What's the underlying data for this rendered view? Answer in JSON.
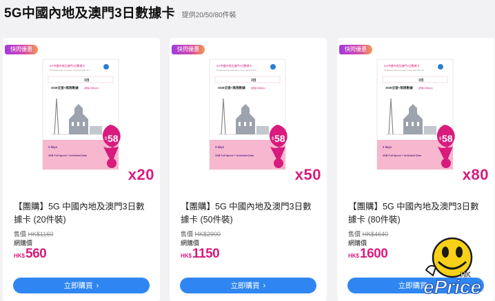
{
  "header": {
    "title": "5G中國內地及澳門3日數據卡",
    "subtitle": "提供20/50/80件裝"
  },
  "card_art": {
    "head": "5G中國內地及澳門3日數據卡",
    "head_en": "5G Mainland China and Macao 3 Days Data SIM Card",
    "days_badge": "3日",
    "mid": "3GB全速+無限數據",
    "mid_note": "(其後128kbps)",
    "days_en": "3 days",
    "data_en": "3GB Full Speed + Unlimited Data",
    "price_tag": "58",
    "price_tag_currency": "$"
  },
  "products": [
    {
      "badge": "快閃優惠",
      "quantity": "x20",
      "name": "【團購】5G 中國內地及澳門3日數據卡 (20件裝)",
      "orig_label": "售價",
      "orig_price": "HK$1160",
      "online_label": "網購價",
      "currency": "HK$",
      "price": "560",
      "button": "立即購買",
      "button_icon": "chevron-right"
    },
    {
      "badge": "快閃優惠",
      "quantity": "x50",
      "name": "【團購】5G 中國內地及澳門3日數據卡 (50件裝)",
      "orig_label": "售價",
      "orig_price": "HK$2900",
      "online_label": "網購價",
      "currency": "HK$",
      "price": "1150",
      "button": "立即購買",
      "button_icon": "chevron-right"
    },
    {
      "badge": "快閃優惠",
      "quantity": "x80",
      "name": "【團購】5G 中國內地及澳門3日數據卡 (80件裝)",
      "orig_label": "售價",
      "orig_price": "HK$4640",
      "online_label": "網購價",
      "currency": "HK$",
      "price": "1600",
      "button": "立即購買",
      "button_icon": "chevron-right"
    }
  ],
  "watermark": {
    "text": "ePrice",
    "region": "HK"
  },
  "colors": {
    "accent": "#d81b7d",
    "button": "#2f86f2",
    "badge_gradient": [
      "#a33be0",
      "#d64ca8",
      "#f39a52"
    ]
  }
}
